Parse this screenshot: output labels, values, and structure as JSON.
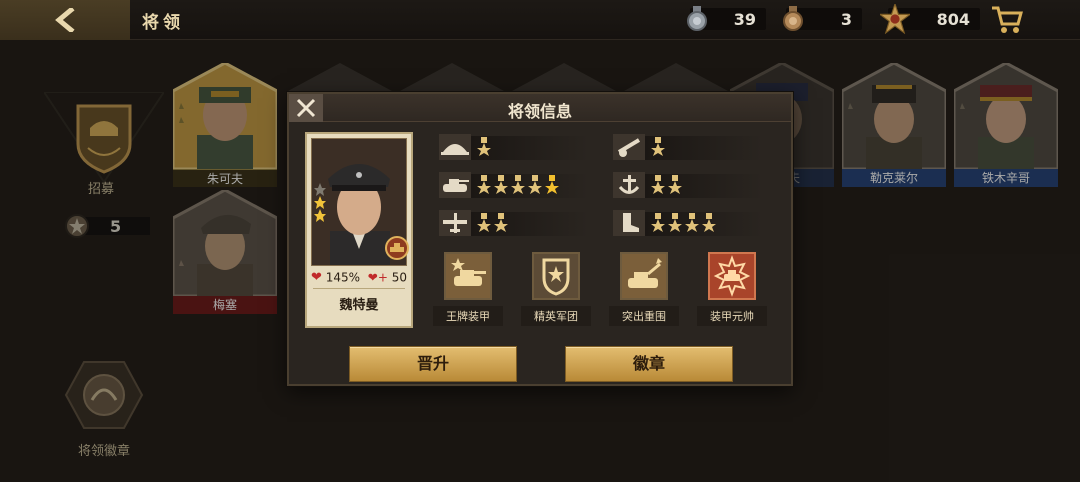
{
  "header": {
    "title": "将领",
    "currencies": [
      {
        "icon": "silver-medal-icon",
        "value": "39"
      },
      {
        "icon": "bronze-medal-icon",
        "value": "3"
      },
      {
        "icon": "gold-badge-icon",
        "value": "804"
      }
    ]
  },
  "sidebar": {
    "recruit_label": "招募",
    "ticket_count": "5",
    "insignia_label": "将领徽章"
  },
  "roster": {
    "names": [
      "朱可夫",
      "梅塞",
      "康利夫",
      "勒克莱尔",
      "铁木辛哥"
    ]
  },
  "modal": {
    "title": "将领信息",
    "general_name": "魏特曼",
    "hp_percent": "145%",
    "heal_value": "50",
    "skills": [
      {
        "icon": "infantry-helmet-icon",
        "medals": 1
      },
      {
        "icon": "tank-icon",
        "medals": 5
      },
      {
        "icon": "airplane-icon",
        "medals": 2
      },
      {
        "icon": "artillery-icon",
        "medals": 1
      },
      {
        "icon": "anchor-icon",
        "medals": 2
      },
      {
        "icon": "boot-icon",
        "medals": 4
      }
    ],
    "traits": [
      "王牌装甲",
      "精英军团",
      "突出重围",
      "装甲元帅"
    ],
    "promote_label": "晋升",
    "badge_label": "徽章"
  },
  "colors": {
    "gold": "#d9b05b",
    "panel": "#2a2520",
    "accent_blue": "#25427a",
    "accent_red": "#6e1a1a"
  }
}
